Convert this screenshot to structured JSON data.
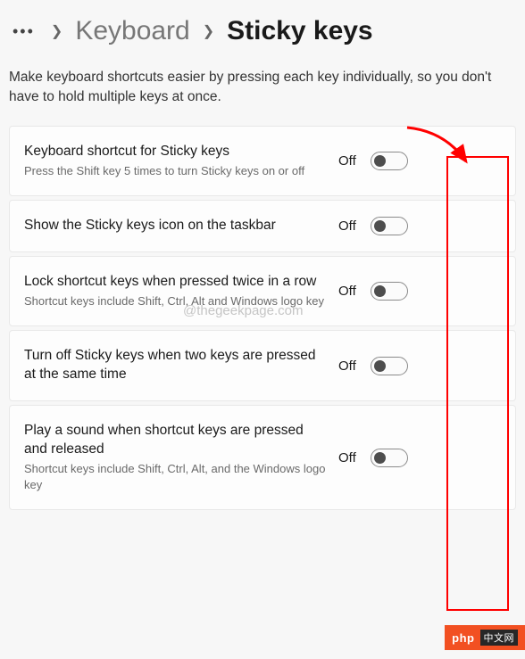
{
  "breadcrumb": {
    "parent": "Keyboard",
    "current": "Sticky keys"
  },
  "description": "Make keyboard shortcuts easier by pressing each key individually, so you don't have to hold multiple keys at once.",
  "settings": [
    {
      "title": "Keyboard shortcut for Sticky keys",
      "sub": "Press the Shift key 5 times to turn Sticky keys on or off",
      "state": "Off"
    },
    {
      "title": "Show the Sticky keys icon on the taskbar",
      "sub": "",
      "state": "Off"
    },
    {
      "title": "Lock shortcut keys when pressed twice in a row",
      "sub": "Shortcut keys include Shift, Ctrl, Alt and Windows logo key",
      "state": "Off"
    },
    {
      "title": "Turn off Sticky keys when two keys are pressed at the same time",
      "sub": "",
      "state": "Off"
    },
    {
      "title": "Play a sound when shortcut keys are pressed and released",
      "sub": "Shortcut keys include Shift, Ctrl, Alt, and the Windows logo key",
      "state": "Off"
    }
  ],
  "watermark": "@thegeekpage.com",
  "badge": {
    "text": "php",
    "cn": "中文网"
  }
}
